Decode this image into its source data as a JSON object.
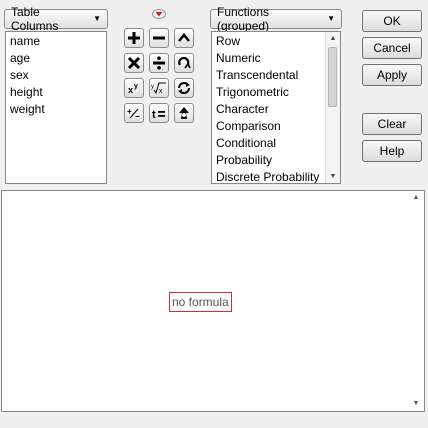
{
  "table_columns": {
    "dropdown_label": "Table Columns",
    "items": [
      "name",
      "age",
      "sex",
      "height",
      "weight"
    ]
  },
  "functions": {
    "dropdown_label": "Functions (grouped)",
    "items": [
      "Row",
      "Numeric",
      "Transcendental",
      "Trigonometric",
      "Character",
      "Comparison",
      "Conditional",
      "Probability",
      "Discrete Probability"
    ]
  },
  "operators": {
    "add": "+",
    "subtract": "−",
    "multiply": "×",
    "divide": "÷",
    "power": "xʸ",
    "root": "ʸ√x",
    "plus_minus": "+/−",
    "assign": "t="
  },
  "buttons": {
    "ok": "OK",
    "cancel": "Cancel",
    "apply": "Apply",
    "clear": "Clear",
    "help": "Help"
  },
  "formula": {
    "placeholder": "no formula"
  },
  "colors": {
    "red_accent": "#cc2222",
    "placeholder_border": "#cc3333"
  }
}
